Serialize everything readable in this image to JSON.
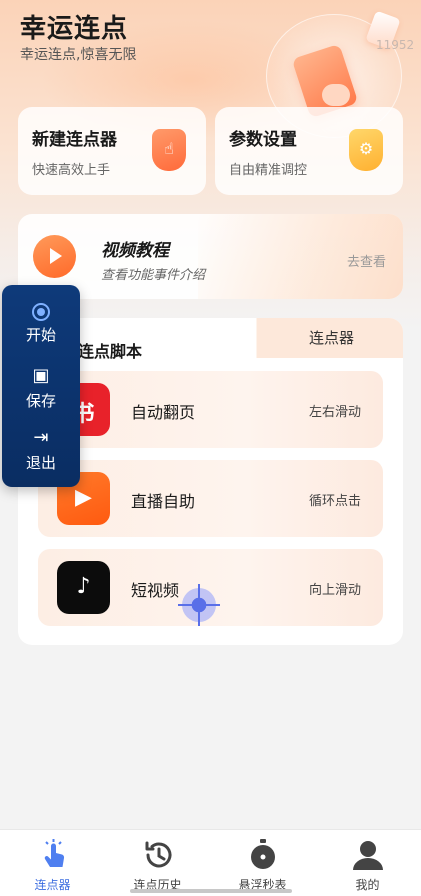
{
  "header": {
    "title": "幸运连点",
    "subtitle": "幸运连点,惊喜无限",
    "watermark": "11952"
  },
  "quick_cards": [
    {
      "title": "新建连点器",
      "subtitle": "快速高效上手",
      "icon": "hand-tap-shield-icon",
      "color": "#ff7a45"
    },
    {
      "title": "参数设置",
      "subtitle": "自由精准调控",
      "icon": "gear-shield-icon",
      "color": "#ffbe3a"
    }
  ],
  "video": {
    "title": "视频教程",
    "subtitle": "查看功能事件介绍",
    "action": "去查看",
    "icon": "play-icon"
  },
  "tabs": {
    "scripts": "连点脚本",
    "clicker": "连点器"
  },
  "scripts": [
    {
      "name": "自动翻页",
      "action": "左右滑动",
      "icon": "redbook-icon"
    },
    {
      "name": "直播自助",
      "action": "循环点击",
      "icon": "kuaishou-icon"
    },
    {
      "name": "短视频",
      "action": "向上滑动",
      "icon": "tiktok-icon"
    }
  ],
  "float_panel": {
    "start": "开始",
    "save": "保存",
    "exit": "退出"
  },
  "bottom_nav": [
    {
      "label": "连点器",
      "icon": "tap-hand-icon",
      "active": true
    },
    {
      "label": "连点历史",
      "icon": "history-icon",
      "active": false
    },
    {
      "label": "悬浮秒表",
      "icon": "stopwatch-icon",
      "active": false
    },
    {
      "label": "我的",
      "icon": "user-icon",
      "active": false
    }
  ],
  "colors": {
    "accent_orange": "#ff6a2a",
    "float_panel_bg": "#0a2d62",
    "active_nav": "#3f6fe0"
  }
}
